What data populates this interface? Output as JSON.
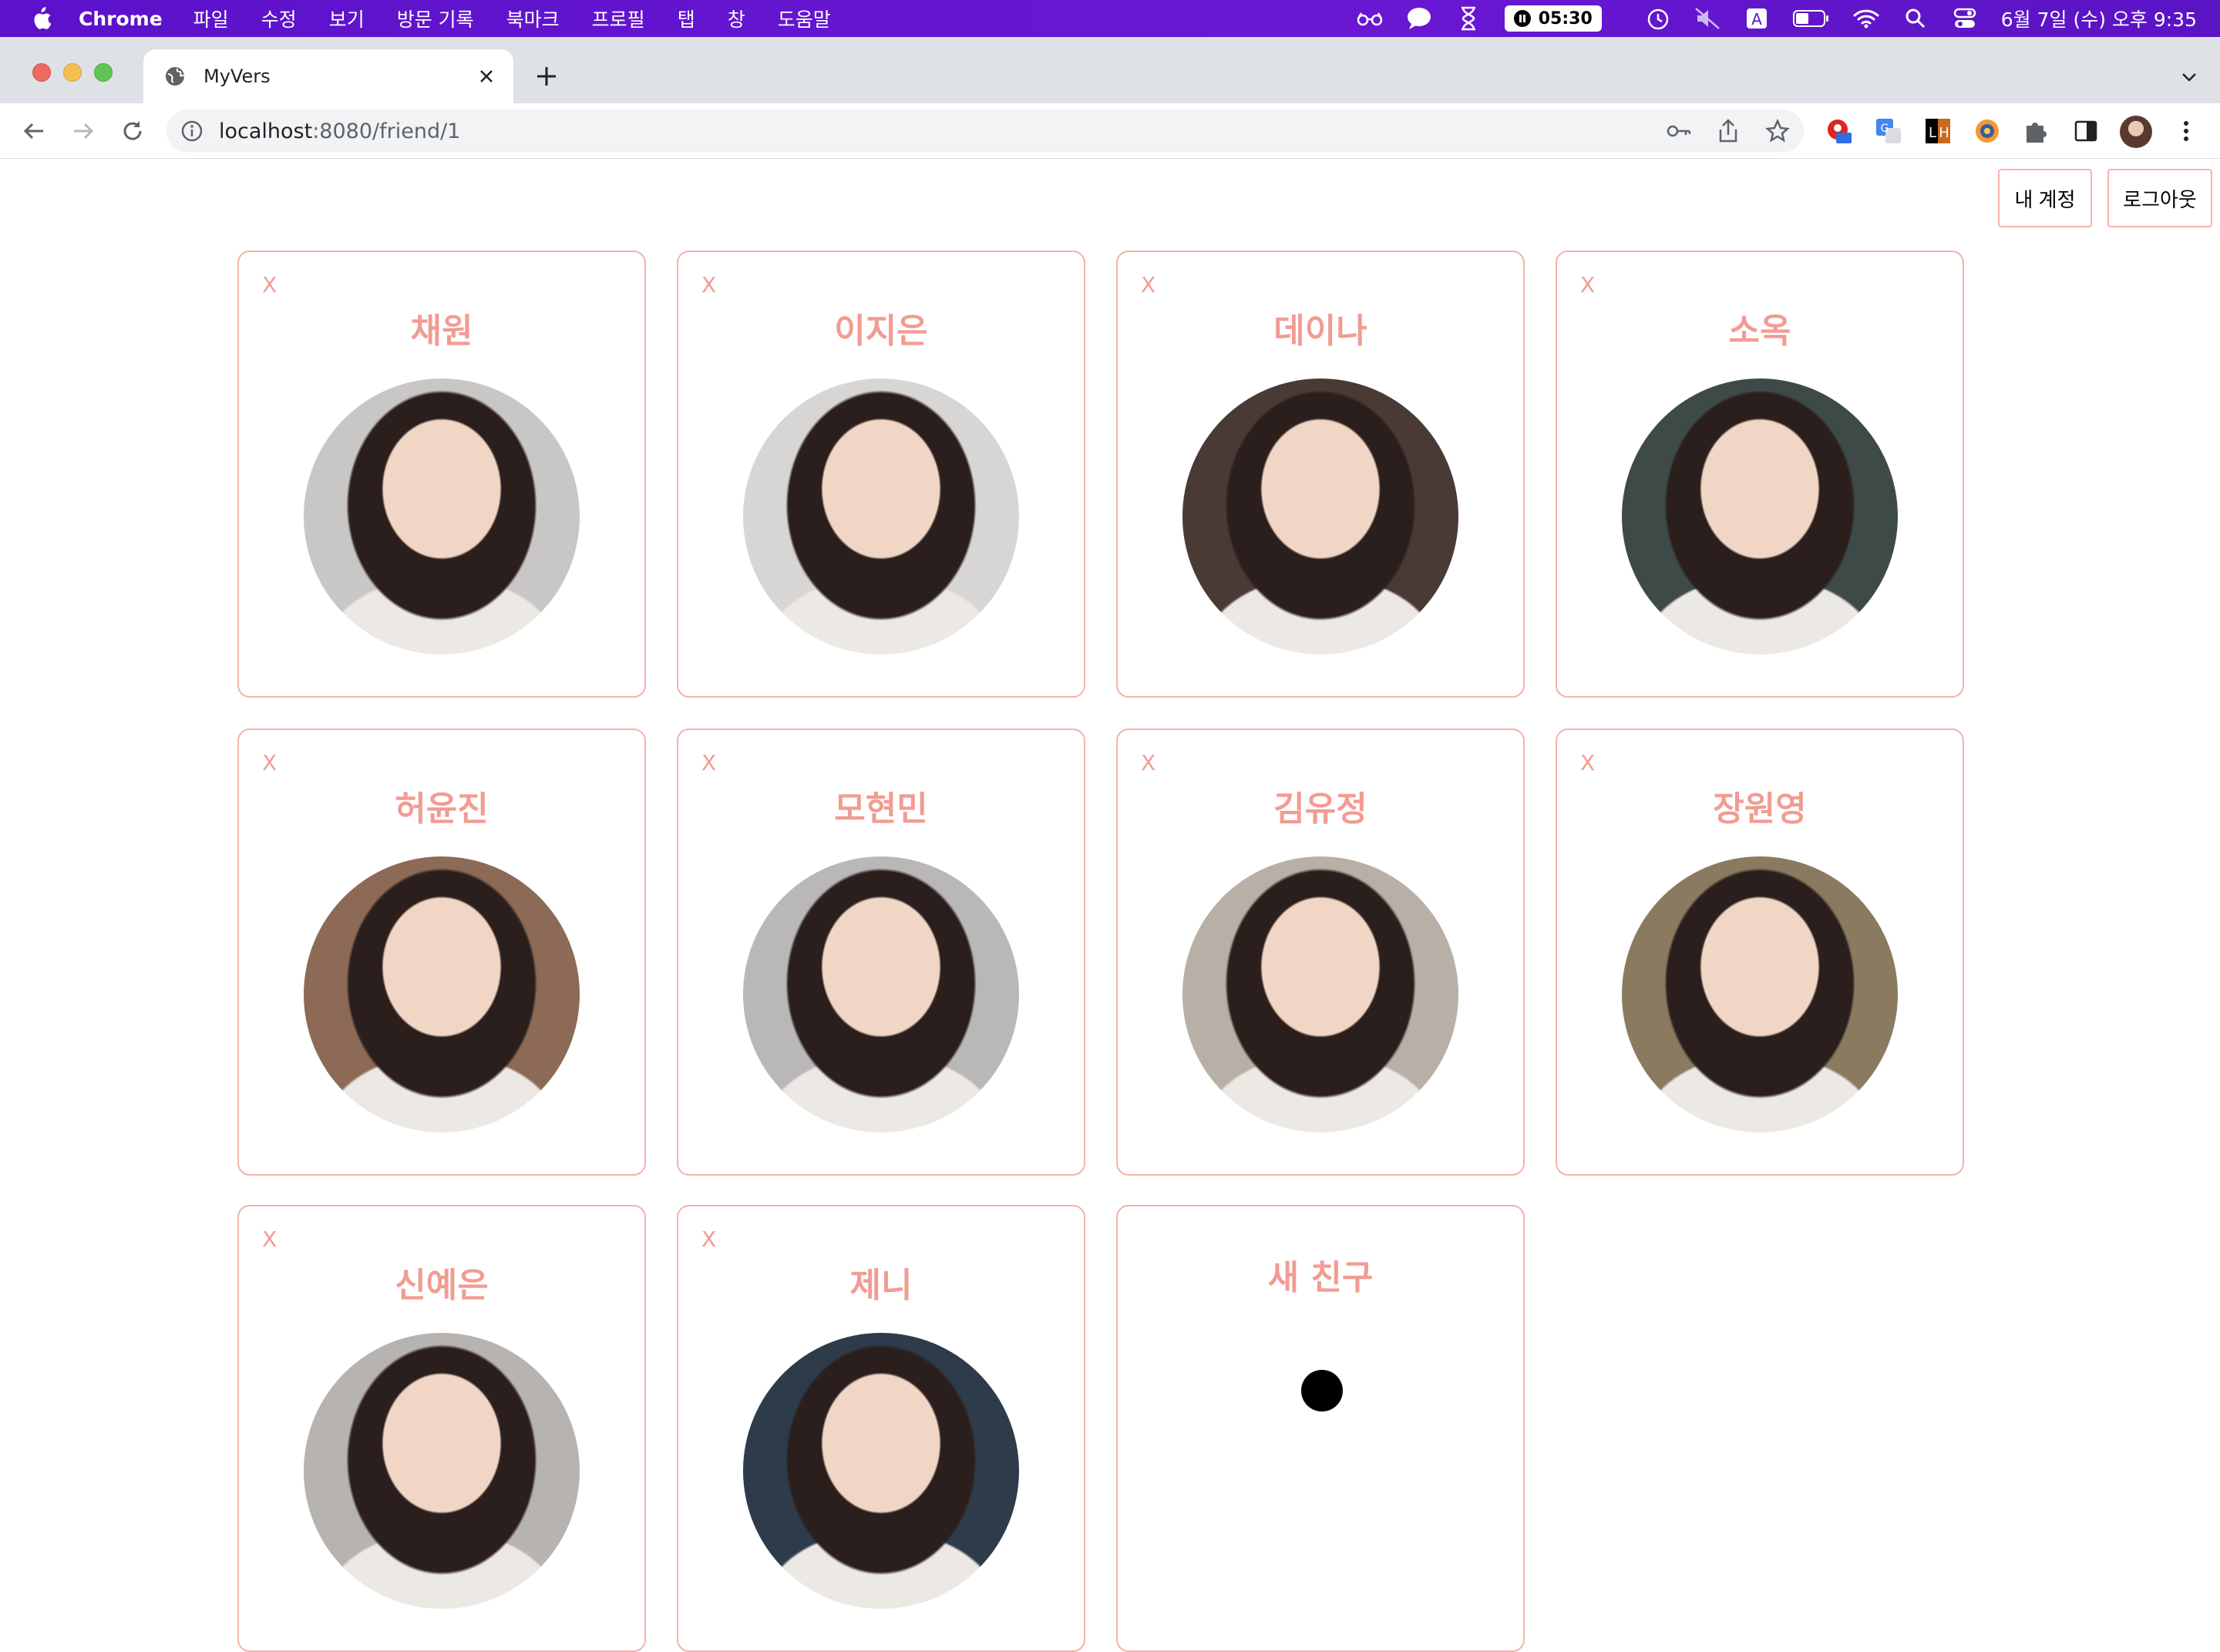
{
  "menubar": {
    "app_name": "Chrome",
    "menus": [
      "파일",
      "수정",
      "보기",
      "방문 기록",
      "북마크",
      "프로필",
      "탭",
      "창",
      "도움말"
    ],
    "timer": "05:30",
    "clock": "6월 7일 (수) 오후 9:35",
    "status_icons": [
      "glasses-icon",
      "message-icon",
      "hourglass-icon",
      "timer-icon",
      "history-icon",
      "mute-icon",
      "input-source-icon",
      "battery-icon",
      "wifi-icon",
      "spotlight-icon",
      "control-center-icon"
    ]
  },
  "browser": {
    "tab_title": "MyVers",
    "url_host": "localhost",
    "url_path": ":8080/friend/1"
  },
  "header": {
    "account_label": "내 계정",
    "logout_label": "로그아웃"
  },
  "friends": [
    {
      "name": "채원",
      "remove": "X",
      "color": "#c9c7c6"
    },
    {
      "name": "이지은",
      "remove": "X",
      "color": "#d8d6d4"
    },
    {
      "name": "데이나",
      "remove": "X",
      "color": "#4a3a36"
    },
    {
      "name": "소옥",
      "remove": "X",
      "color": "#3e4a48"
    },
    {
      "name": "허윤진",
      "remove": "X",
      "color": "#8c6a56"
    },
    {
      "name": "모현민",
      "remove": "X",
      "color": "#b9b7b8"
    },
    {
      "name": "김유정",
      "remove": "X",
      "color": "#b8b0a6"
    },
    {
      "name": "장원영",
      "remove": "X",
      "color": "#8a7a60"
    },
    {
      "name": "신예은",
      "remove": "X",
      "color": "#b7b3b0"
    },
    {
      "name": "제니",
      "remove": "X",
      "color": "#2d3b4a"
    }
  ],
  "new_friend": {
    "label": "새 친구"
  },
  "colors": {
    "accent": "#f19c93",
    "border": "#f3b2aa",
    "menubar": "#6015cc"
  }
}
